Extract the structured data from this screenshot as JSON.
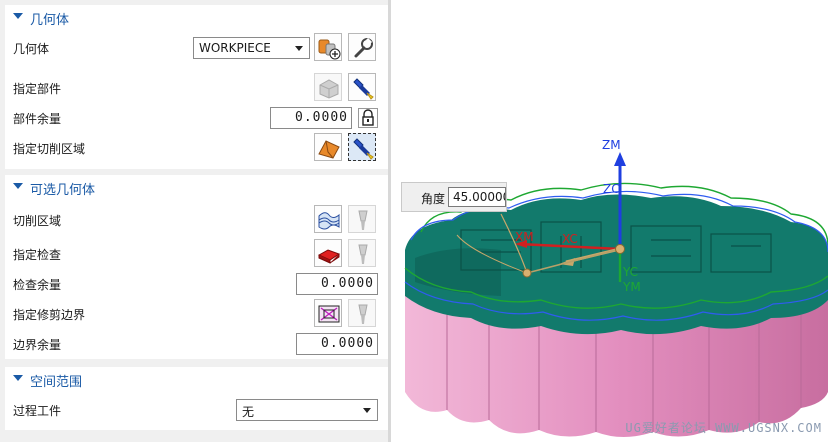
{
  "geometry_section": {
    "title": "几何体",
    "geometry_label": "几何体",
    "geometry_value": "WORKPIECE",
    "part_label": "指定部件",
    "part_stock_label": "部件余量",
    "part_stock_value": "0.0000",
    "cut_area_label": "指定切削区域"
  },
  "optional_section": {
    "title": "可选几何体",
    "cut_region_label": "切削区域",
    "check_label": "指定检查",
    "check_stock_label": "检查余量",
    "check_stock_value": "0.0000",
    "trim_label": "指定修剪边界",
    "trim_stock_label": "边界余量",
    "trim_stock_value": "0.0000"
  },
  "range_section": {
    "title": "空间范围",
    "ipw_label": "过程工件",
    "ipw_value": "无"
  },
  "viewport": {
    "angle_label": "角度",
    "angle_value": "45.000000",
    "axis_zm": "ZM",
    "axis_zc": "ZC",
    "axis_xm": "XM",
    "axis_xc": "XC",
    "axis_yc": "YC",
    "axis_ym": "YM",
    "watermark": "UG爱好者论坛 WWW.UGSNX.COM"
  },
  "colors": {
    "accent": "#1a5aa6",
    "model_top": "#127a6c",
    "model_side": "#e69ac4",
    "axis_blue": "#1f3fe0",
    "axis_red": "#d02020",
    "axis_green": "#1ea832"
  },
  "icons": [
    "create-geometry-icon",
    "edit-wrench-icon",
    "select-part-icon",
    "flashlight-icon",
    "lock-icon",
    "cut-area-icon",
    "cut-region-icon",
    "check-geometry-icon",
    "trim-boundary-icon"
  ]
}
